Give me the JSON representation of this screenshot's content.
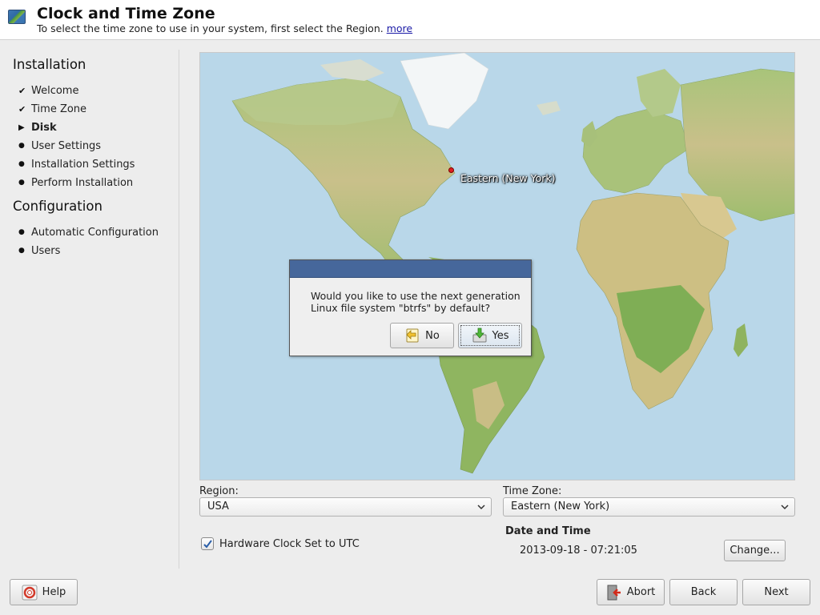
{
  "header": {
    "title": "Clock and Time Zone",
    "subtitle": "To select the time zone to use in your system, first select the Region.",
    "more_link": "more",
    "icon": "world-map-icon"
  },
  "sidebar": {
    "installation_title": "Installation",
    "installation_steps": [
      {
        "label": "Welcome",
        "state": "done",
        "mark": "✔"
      },
      {
        "label": "Time Zone",
        "state": "done",
        "mark": "✔"
      },
      {
        "label": "Disk",
        "state": "current",
        "mark": "▶"
      },
      {
        "label": "User Settings",
        "state": "pending",
        "mark": "●"
      },
      {
        "label": "Installation Settings",
        "state": "pending",
        "mark": "●"
      },
      {
        "label": "Perform Installation",
        "state": "pending",
        "mark": "●"
      }
    ],
    "configuration_title": "Configuration",
    "configuration_steps": [
      {
        "label": "Automatic Configuration",
        "state": "pending",
        "mark": "●"
      },
      {
        "label": "Users",
        "state": "pending",
        "mark": "●"
      }
    ]
  },
  "map": {
    "selected_zone_label": "Eastern (New York)",
    "colors": {
      "ocean": "#b6d5e7",
      "land": "#c8c28a",
      "green": "#8fb56a",
      "marker": "#e02020"
    }
  },
  "dialog": {
    "message_line1": "Would you like to use the next generation",
    "message_line2": "Linux file system \"btrfs\" by default?",
    "no_label": "No",
    "yes_label": "Yes"
  },
  "form": {
    "region_label": "Region:",
    "region_value": "USA",
    "timezone_label": "Time Zone:",
    "timezone_value": "Eastern (New York)",
    "hw_clock_label": "Hardware Clock Set to UTC",
    "hw_clock_checked": true,
    "date_time_title": "Date and Time",
    "date_time_value": "2013-09-18 - 07:21:05",
    "change_label": "Change..."
  },
  "footer": {
    "help_label": "Help",
    "abort_label": "Abort",
    "back_label": "Back",
    "next_label": "Next"
  }
}
